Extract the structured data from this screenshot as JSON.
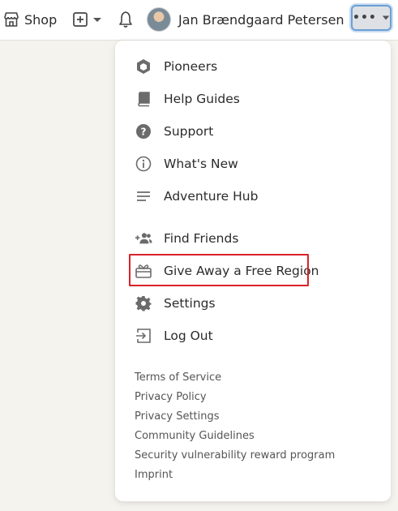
{
  "topbar": {
    "shop_label": "Shop",
    "user_name": "Jan Brændgaard Petersen",
    "more_label": "•••"
  },
  "menu": {
    "primary_items": [
      {
        "label": "Pioneers",
        "icon": "hexagon-icon"
      },
      {
        "label": "Help Guides",
        "icon": "book-icon"
      },
      {
        "label": "Support",
        "icon": "question-circle-icon"
      },
      {
        "label": "What's New",
        "icon": "info-circle-icon"
      },
      {
        "label": "Adventure Hub",
        "icon": "lines-icon"
      }
    ],
    "secondary_items": [
      {
        "label": "Find Friends",
        "icon": "add-friends-icon"
      },
      {
        "label": "Give Away a Free Region",
        "icon": "gift-card-icon"
      },
      {
        "label": "Settings",
        "icon": "gear-icon"
      },
      {
        "label": "Log Out",
        "icon": "logout-icon"
      }
    ],
    "footer_links": [
      "Terms of Service",
      "Privacy Policy",
      "Privacy Settings",
      "Community Guidelines",
      "Security vulnerability reward program",
      "Imprint"
    ]
  },
  "colors": {
    "highlight": "#d9222a",
    "accent_border": "#6c9fd6"
  }
}
